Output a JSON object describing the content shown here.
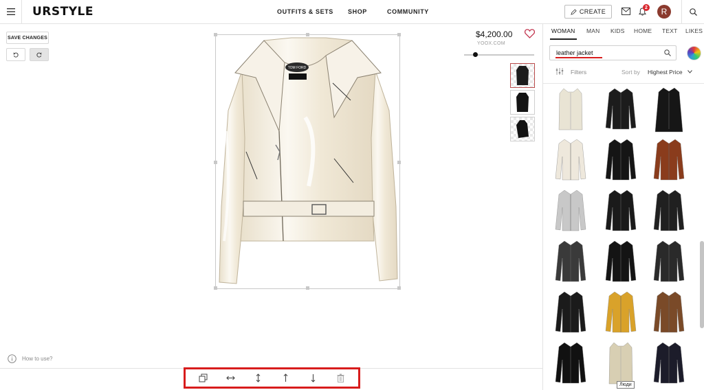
{
  "header": {
    "logo": "URSTYLE",
    "nav": [
      "OUTFITS & SETS",
      "SHOP",
      "COMMUNITY"
    ],
    "create_label": "CREATE",
    "notification_count": "2",
    "avatar_initial": "R"
  },
  "editor": {
    "save_label": "SAVE CHANGES",
    "howto_label": "How to use?"
  },
  "item": {
    "price": "$4,200.00",
    "store": "YOOX.COM",
    "brand_label": "TOM FORD",
    "size_slider_fraction": 0.16
  },
  "toolbar": {
    "tools": [
      "copy-icon",
      "flip-horizontal-icon",
      "flip-vertical-icon",
      "bring-forward-icon",
      "send-backward-icon",
      "trash-icon"
    ]
  },
  "panel": {
    "tabs": [
      "WOMAN",
      "MAN",
      "KIDS",
      "HOME",
      "TEXT",
      "LIKES"
    ],
    "active_tab": "WOMAN",
    "search_value": "leather jacket",
    "filters_label": "Filters",
    "sort_label": "Sort by",
    "sort_value": "Highest Price",
    "tooltip": "Люди",
    "products": [
      {
        "kind": "vest",
        "color": "#e9e4d4"
      },
      {
        "kind": "jacket",
        "color": "#1c1c1c"
      },
      {
        "kind": "coat",
        "color": "#161616"
      },
      {
        "kind": "jacket",
        "color": "#eee8dc"
      },
      {
        "kind": "jacket",
        "color": "#151515"
      },
      {
        "kind": "jacket",
        "color": "#8a3c1c"
      },
      {
        "kind": "jacket",
        "color": "#c8c8c8"
      },
      {
        "kind": "jacket",
        "color": "#1a1a1a"
      },
      {
        "kind": "jacket",
        "color": "#202020"
      },
      {
        "kind": "jacket",
        "color": "#3a3a3a"
      },
      {
        "kind": "jacket",
        "color": "#141414"
      },
      {
        "kind": "jacket",
        "color": "#2a2a2a"
      },
      {
        "kind": "jacket",
        "color": "#1b1b1b"
      },
      {
        "kind": "jacket",
        "color": "#d9a22a"
      },
      {
        "kind": "jacket",
        "color": "#7a4a28"
      },
      {
        "kind": "jacket",
        "color": "#111111"
      },
      {
        "kind": "vest",
        "color": "#d8cfb3"
      },
      {
        "kind": "jacket",
        "color": "#1c1c2a"
      }
    ]
  },
  "colors": {
    "accent_red": "#d81c1c",
    "heart": "#c2364f",
    "jacket": "#f3ecdf"
  }
}
